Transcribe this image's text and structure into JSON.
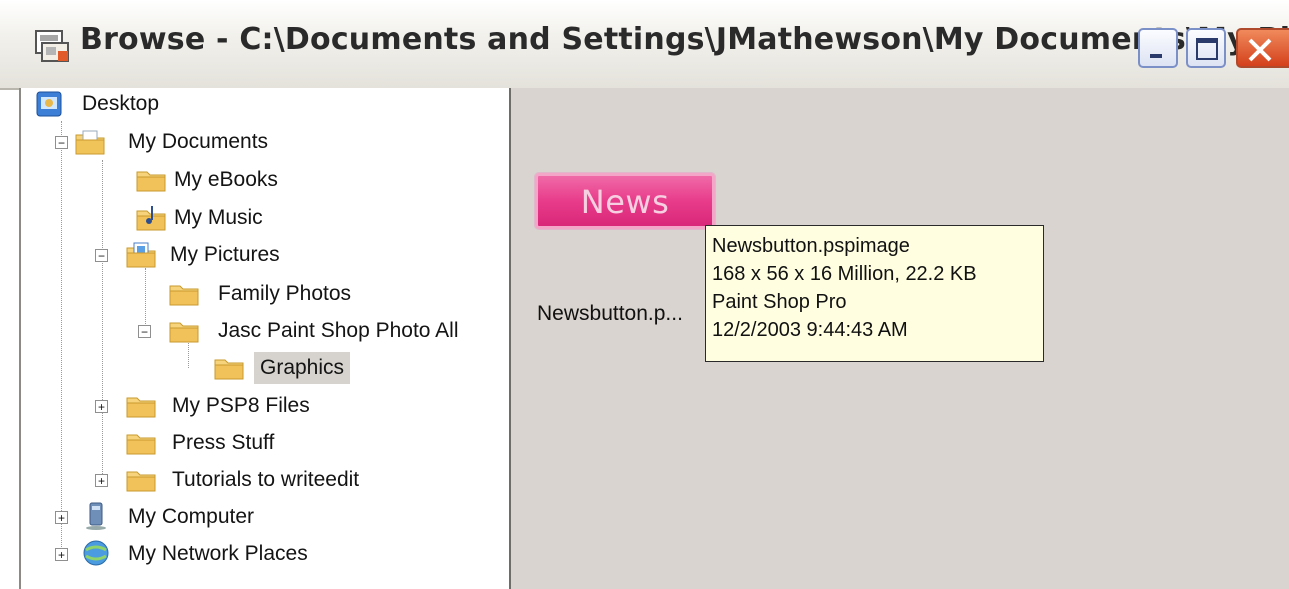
{
  "window": {
    "title": "Browse - C:\\Documents and Settings\\JMathewson\\My Documents\\My Pi...",
    "buttons": {
      "minimize": "minimize",
      "maximize": "maximize",
      "close": "close"
    }
  },
  "tree": {
    "items": [
      {
        "label": "Desktop",
        "icon": "desktop-icon"
      },
      {
        "label": "My Documents",
        "icon": "documents-folder-icon",
        "expander": "−"
      },
      {
        "label": "My eBooks",
        "icon": "folder-icon"
      },
      {
        "label": "My Music",
        "icon": "music-folder-icon"
      },
      {
        "label": "My Pictures",
        "icon": "pictures-folder-icon",
        "expander": "−"
      },
      {
        "label": "Family Photos",
        "icon": "folder-icon"
      },
      {
        "label": "Jasc Paint Shop Photo All",
        "icon": "folder-icon",
        "expander": "−"
      },
      {
        "label": "Graphics",
        "icon": "folder-icon",
        "selected": true
      },
      {
        "label": "My PSP8 Files",
        "icon": "folder-icon",
        "expander": "+"
      },
      {
        "label": "Press Stuff",
        "icon": "folder-icon"
      },
      {
        "label": "Tutorials to writeedit",
        "icon": "folder-icon",
        "expander": "+"
      },
      {
        "label": "My Computer",
        "icon": "computer-icon",
        "expander": "+"
      },
      {
        "label": "My Network Places",
        "icon": "network-icon",
        "expander": "+"
      }
    ]
  },
  "content": {
    "thumbnail_text": "News",
    "file_label": "Newsbutton.p...",
    "tooltip": {
      "line1": "Newsbutton.pspimage",
      "line2": "168 x 56 x 16 Million, 22.2 KB",
      "line3": "Paint Shop Pro",
      "line4": "12/2/2003 9:44:43 AM"
    }
  },
  "colors": {
    "thumbnail": "#e83c8a",
    "tooltip_bg": "#fffee1",
    "pane_bg": "#d9d4cf",
    "selection": "#d6d3ce"
  }
}
